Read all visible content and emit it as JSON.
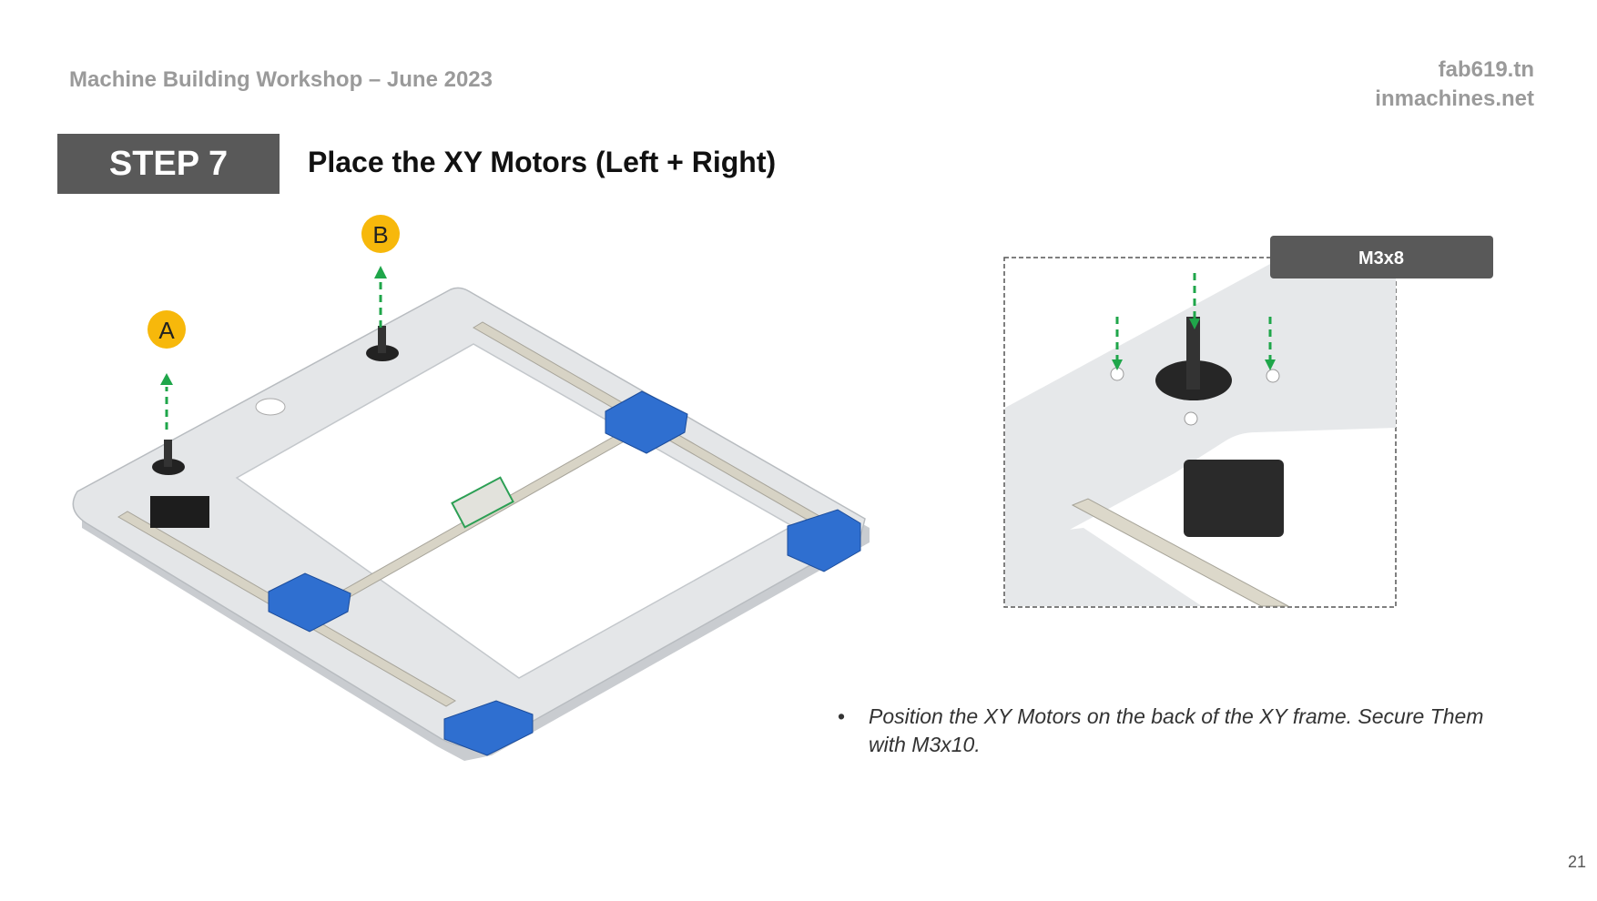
{
  "header": {
    "workshop_title": "Machine Building Workshop – June 2023",
    "site_1": "fab619.tn",
    "site_2": "inmachines.net"
  },
  "step": {
    "label": "STEP 7",
    "title": "Place the XY Motors (Left + Right)"
  },
  "markers": {
    "a": "A",
    "b": "B"
  },
  "detail": {
    "screw_label": "M3x8"
  },
  "instructions": [
    "Position the XY Motors on the back of the XY frame. Secure Them with M3x10."
  ],
  "page_number": "21",
  "colors": {
    "accent_yellow": "#f7b80b",
    "arrow_green": "#1fa64a",
    "part_blue": "#2f6fd0",
    "label_gray": "#595959"
  }
}
